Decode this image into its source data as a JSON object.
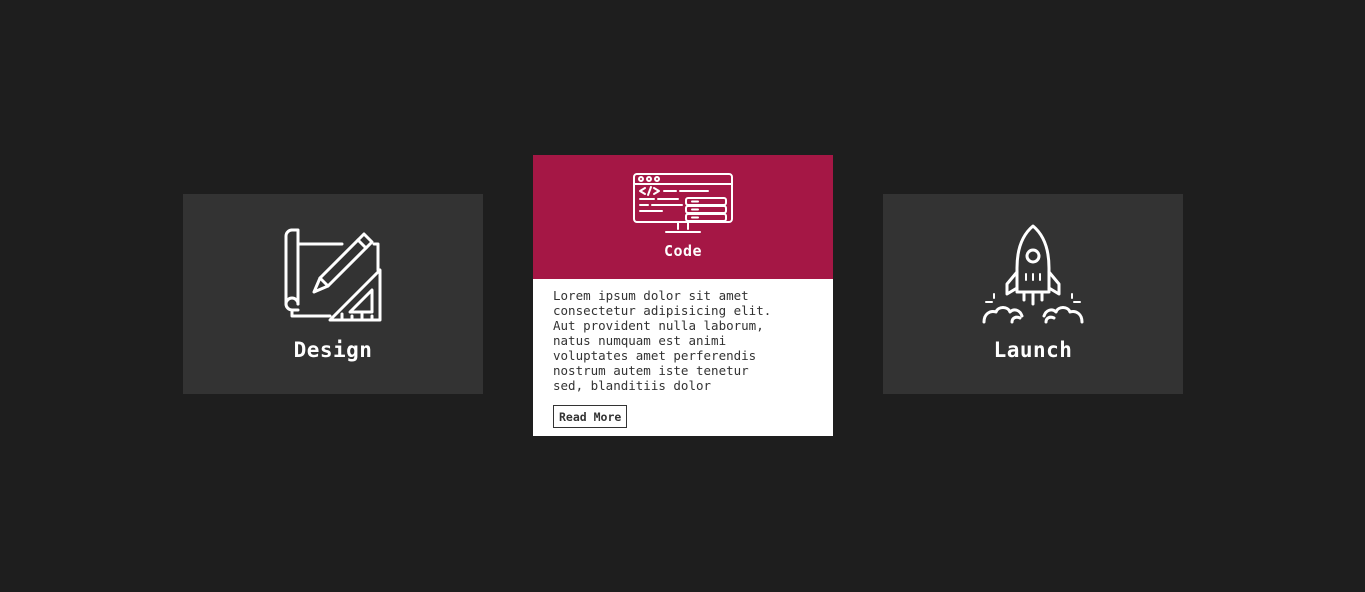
{
  "cards": [
    {
      "id": "design",
      "title": "Design",
      "icon": "blueprint-pencil-icon"
    },
    {
      "id": "code",
      "title": "Code",
      "icon": "code-monitor-icon",
      "description": "Lorem ipsum dolor sit amet\nconsectetur adipisicing elit.\nAut provident nulla laborum,\nnatus numquam est animi\nvoluptates amet perferendis\nnostrum autem iste tenetur\nsed, blanditiis dolor",
      "button_label": "Read More"
    },
    {
      "id": "launch",
      "title": "Launch",
      "icon": "rocket-launch-icon"
    }
  ],
  "colors": {
    "background": "#1e1e1e",
    "card": "#333333",
    "accent": "#a51745",
    "text_light": "#ffffff",
    "text_dark": "#333333"
  }
}
